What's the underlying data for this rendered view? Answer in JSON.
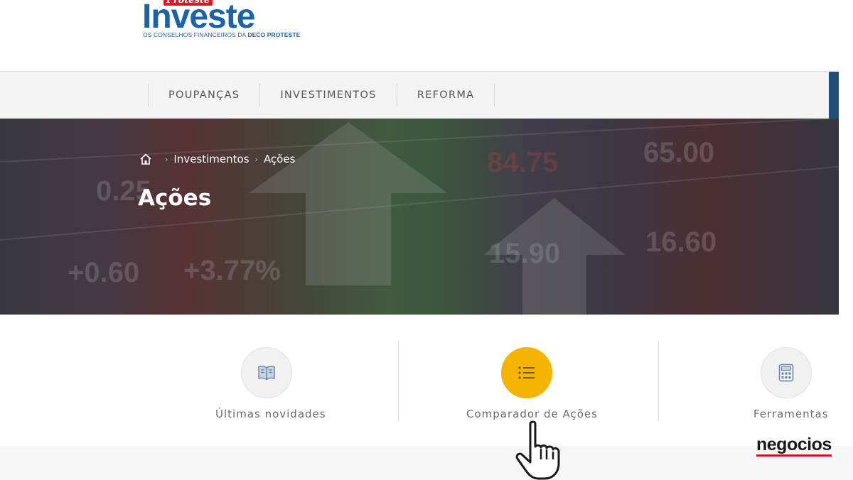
{
  "logo": {
    "top_word": "Proteste",
    "main_word": "Investe",
    "tagline_prefix": "OS CONSELHOS FINANCEIROS DA ",
    "tagline_bold": "DECO PROTESTE"
  },
  "nav": {
    "items": [
      {
        "label": "POUPANÇAS"
      },
      {
        "label": "INVESTIMENTOS"
      },
      {
        "label": "REFORMA"
      }
    ]
  },
  "hero": {
    "breadcrumb": {
      "home_icon": "home-icon",
      "items": [
        "Investimentos",
        "Ações"
      ],
      "separator": "›"
    },
    "title": "Ações",
    "background_numbers": [
      "+0.60",
      "+3.77%",
      "84.75",
      "15.90",
      "16.60",
      "65.00",
      "0.25"
    ]
  },
  "tiles": [
    {
      "label": "Últimas novidades",
      "icon": "book-icon",
      "active": false
    },
    {
      "label": "Comparador de Ações",
      "icon": "list-icon",
      "active": true
    },
    {
      "label": "Ferramentas",
      "icon": "calculator-icon",
      "active": false
    }
  ],
  "watermark": {
    "text": "negocios"
  },
  "colors": {
    "brand_blue": "#1a63a8",
    "brand_red": "#d21f26",
    "accent_yellow": "#f5b400",
    "nav_accent": "#1f4f74"
  }
}
